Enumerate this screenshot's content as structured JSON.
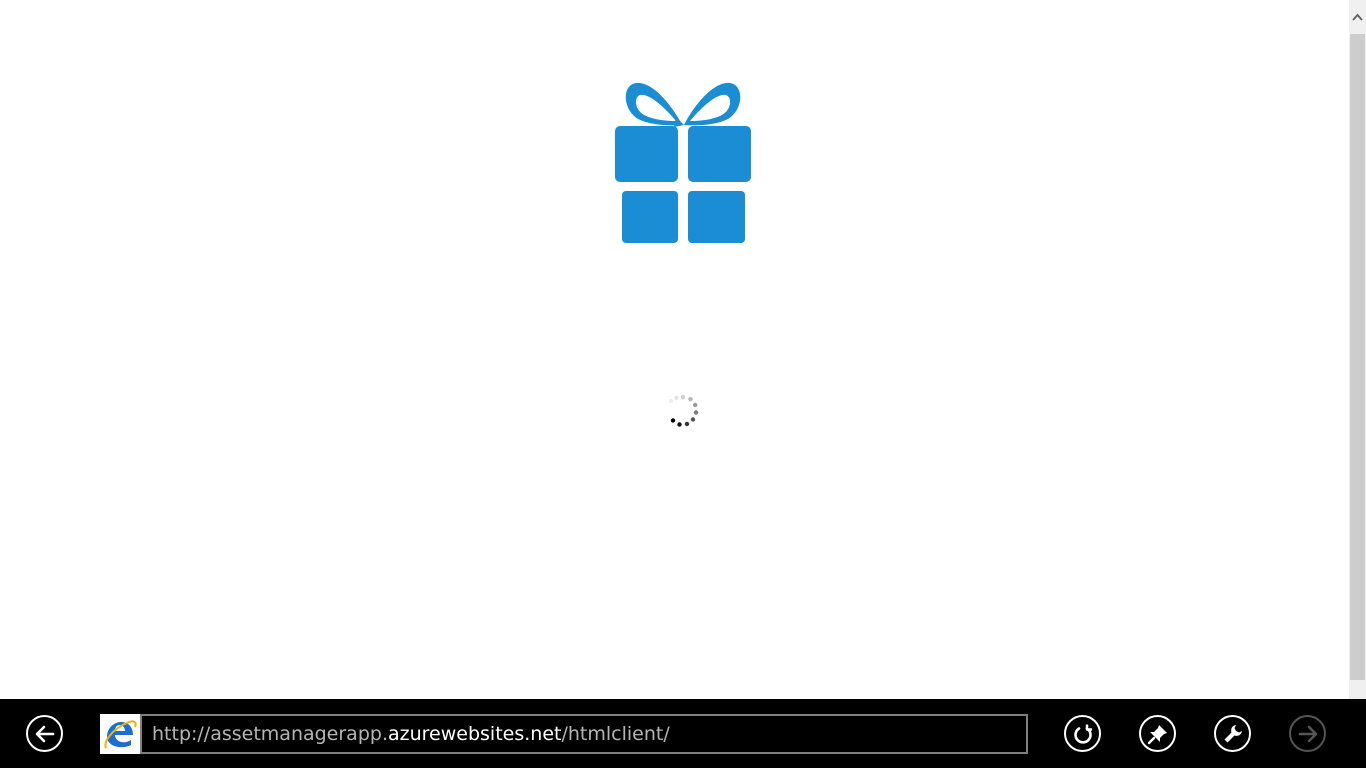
{
  "page": {
    "logo_icon": "gift-icon",
    "logo_color": "#1a8dd4",
    "spinner_icon": "loading-spinner-icon"
  },
  "scrollbar": {
    "up_arrow_icon": "chevron-up-icon"
  },
  "appbar": {
    "back_icon": "arrow-left-icon",
    "browser_icon": "internet-explorer-icon",
    "url": {
      "prefix": "http://assetmanagerapp.",
      "host": "azurewebsites.net",
      "suffix": "/htmlclient/"
    },
    "refresh_icon": "refresh-icon",
    "pin_icon": "pin-icon",
    "tools_icon": "wrench-icon",
    "forward_icon": "arrow-right-icon"
  }
}
